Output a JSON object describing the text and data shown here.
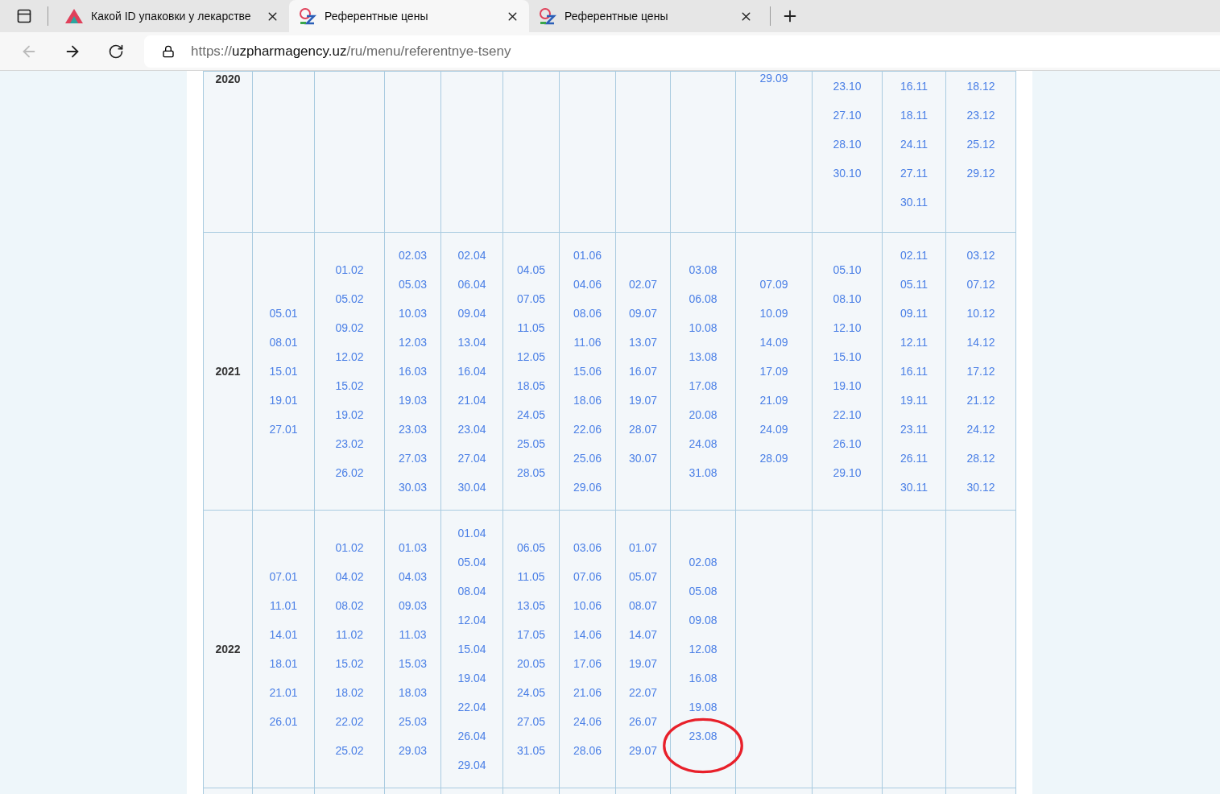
{
  "tabs": [
    {
      "title": "Какой ID упаковки у лекарстве",
      "kind": "triangle",
      "selected": false
    },
    {
      "title": "Референтные цены",
      "kind": "pharmacy",
      "selected": true
    },
    {
      "title": "Референтные цены",
      "kind": "pharmacy",
      "selected": false
    }
  ],
  "address_bar": {
    "scheme": "https://",
    "host": "uzpharmagency.uz",
    "path": "/ru/menu/referentnye-tseny"
  },
  "table": {
    "rows": [
      {
        "year": "2020",
        "months": [
          {
            "kind": "blank"
          },
          {
            "kind": "blank"
          },
          {
            "kind": "blank"
          },
          {
            "kind": "blank"
          },
          {
            "kind": "blank"
          },
          {
            "kind": "blank"
          },
          {
            "kind": "blank"
          },
          {
            "kind": "blank"
          },
          {
            "dates": [
              "29.09"
            ]
          },
          {
            "dates": [
              "23.10",
              "27.10",
              "28.10",
              "30.10"
            ]
          },
          {
            "dates": [
              "16.11",
              "18.11",
              "24.11",
              "27.11",
              "30.11"
            ]
          },
          {
            "dates": [
              "18.12",
              "23.12",
              "25.12",
              "29.12"
            ]
          }
        ]
      },
      {
        "year": "2021",
        "months": [
          {
            "dates": [
              "05.01",
              "08.01",
              "15.01",
              "19.01",
              "27.01"
            ]
          },
          {
            "dates": [
              "01.02",
              "05.02",
              "09.02",
              "12.02",
              "15.02",
              "19.02",
              "23.02",
              "26.02"
            ]
          },
          {
            "dates": [
              "02.03",
              "05.03",
              "10.03",
              "12.03",
              "16.03",
              "19.03",
              "23.03",
              "27.03",
              "30.03"
            ]
          },
          {
            "dates": [
              "02.04",
              "06.04",
              "09.04",
              "13.04",
              "16.04",
              "21.04",
              "23.04",
              "27.04",
              "30.04"
            ]
          },
          {
            "dates": [
              "04.05",
              "07.05",
              "11.05",
              "12.05",
              "18.05",
              "24.05",
              "25.05",
              "28.05"
            ]
          },
          {
            "dates": [
              "01.06",
              "04.06",
              "08.06",
              "11.06",
              "15.06",
              "18.06",
              "22.06",
              "25.06",
              "29.06"
            ]
          },
          {
            "dates": [
              "02.07",
              "09.07",
              "13.07",
              "16.07",
              "19.07",
              "28.07",
              "30.07"
            ]
          },
          {
            "dates": [
              "03.08",
              "06.08",
              "10.08",
              "13.08",
              "17.08",
              "20.08",
              "24.08",
              "31.08"
            ]
          },
          {
            "dates": [
              "07.09",
              "10.09",
              "14.09",
              "17.09",
              "21.09",
              "24.09",
              "28.09"
            ]
          },
          {
            "dates": [
              "05.10",
              "08.10",
              "12.10",
              "15.10",
              "19.10",
              "22.10",
              "26.10",
              "29.10"
            ]
          },
          {
            "dates": [
              "02.11",
              "05.11",
              "09.11",
              "12.11",
              "16.11",
              "19.11",
              "23.11",
              "26.11",
              "30.11"
            ]
          },
          {
            "dates": [
              "03.12",
              "07.12",
              "10.12",
              "14.12",
              "17.12",
              "21.12",
              "24.12",
              "28.12",
              "30.12"
            ]
          }
        ]
      },
      {
        "year": "2022",
        "months": [
          {
            "dates": [
              "07.01",
              "11.01",
              "14.01",
              "18.01",
              "21.01",
              "26.01"
            ]
          },
          {
            "dates": [
              "01.02",
              "04.02",
              "08.02",
              "11.02",
              "15.02",
              "18.02",
              "22.02",
              "25.02"
            ]
          },
          {
            "dates": [
              "01.03",
              "04.03",
              "09.03",
              "11.03",
              "15.03",
              "18.03",
              "25.03",
              "29.03"
            ]
          },
          {
            "dates": [
              "01.04",
              "05.04",
              "08.04",
              "12.04",
              "15.04",
              "19.04",
              "22.04",
              "26.04",
              "29.04"
            ]
          },
          {
            "dates": [
              "06.05",
              "11.05",
              "13.05",
              "17.05",
              "20.05",
              "24.05",
              "27.05",
              "31.05"
            ]
          },
          {
            "dates": [
              "03.06",
              "07.06",
              "10.06",
              "14.06",
              "17.06",
              "21.06",
              "24.06",
              "28.06"
            ]
          },
          {
            "dates": [
              "01.07",
              "05.07",
              "08.07",
              "14.07",
              "19.07",
              "22.07",
              "26.07",
              "29.07"
            ]
          },
          {
            "dates": [
              "02.08",
              "05.08",
              "09.08",
              "12.08",
              "16.08",
              "19.08"
            ],
            "circled": [
              "23.08"
            ]
          },
          {
            "kind": "blank"
          },
          {
            "kind": "blank"
          },
          {
            "kind": "blank"
          },
          {
            "kind": "blank"
          }
        ]
      }
    ]
  }
}
